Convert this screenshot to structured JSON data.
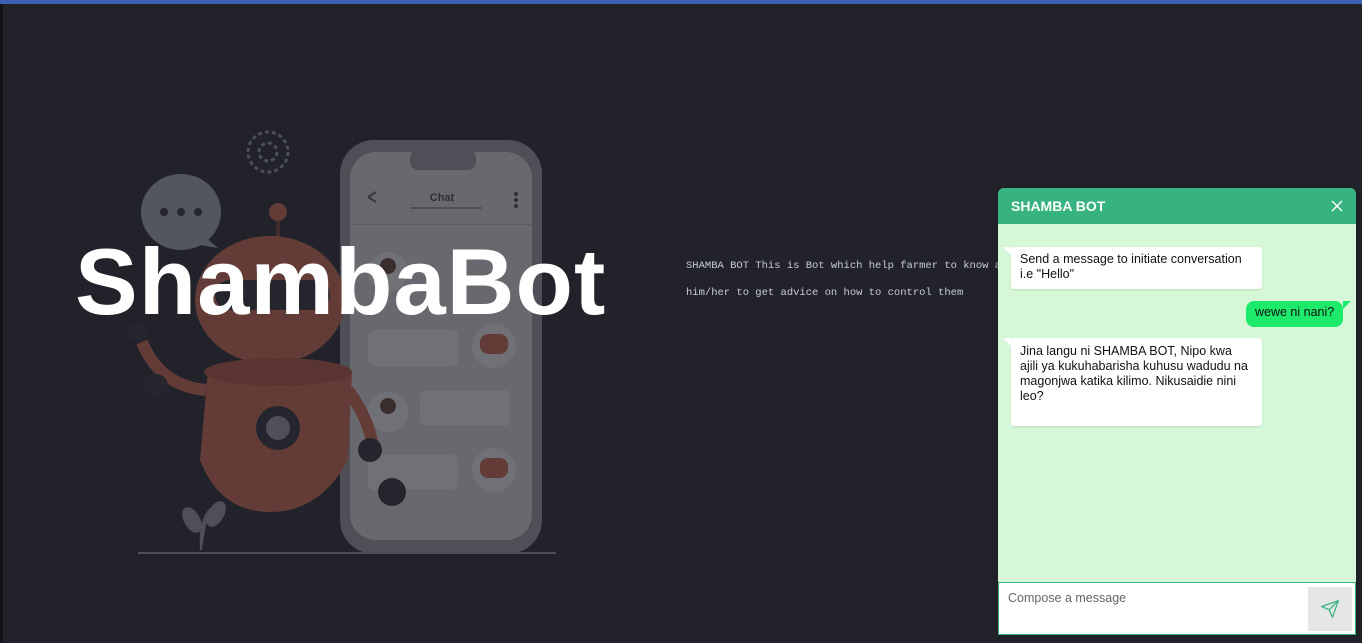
{
  "hero": {
    "title": "ShambaBot"
  },
  "illustration": {
    "phone_title": "Chat",
    "icon": "robot-phone-chat-illustration"
  },
  "description": {
    "line1": "SHAMBA BOT This is Bot which help farmer to know about",
    "line2": "him/her to get advice on how to control them"
  },
  "chat": {
    "title": "SHAMBA BOT",
    "close_icon": "close-icon",
    "messages": [
      {
        "sender": "bot",
        "text": "Send a message to initiate conversation i.e \"Hello\""
      },
      {
        "sender": "user",
        "text": "wewe ni nani?"
      },
      {
        "sender": "bot",
        "text": "Jina langu ni SHAMBA BOT, Nipo kwa ajili ya kukuhabarisha kuhusu wadudu na magonjwa katika kilimo. Nikusaidie nini leo?"
      }
    ],
    "input": {
      "placeholder": "Compose a message",
      "value": ""
    },
    "send_icon": "send-icon"
  },
  "colors": {
    "background": "#22232a",
    "top_bar": "#3d5fb4",
    "chat_header": "#36b37e",
    "chat_body": "#d6f8d9",
    "user_bubble": "#1de96b",
    "bot_bubble": "#ffffff"
  }
}
